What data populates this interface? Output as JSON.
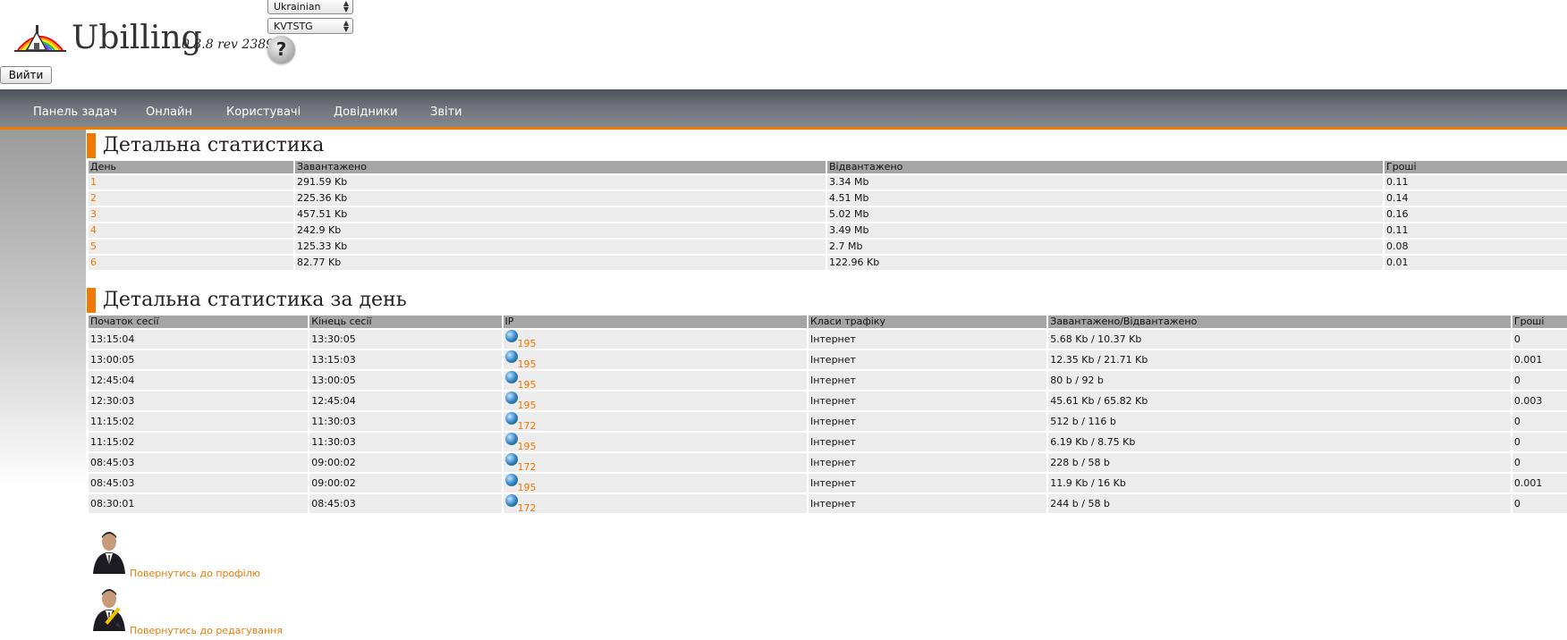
{
  "header": {
    "app_name": "Ubilling",
    "version": "0.3.8 rev 2389",
    "language_select": "Ukrainian",
    "skin_select": "KVTSTG",
    "help_symbol": "?",
    "logout_label": "Вийти"
  },
  "nav": {
    "items": [
      "Панель задач",
      "Онлайн",
      "Користувачі",
      "Довідники",
      "Звіти"
    ]
  },
  "colors": {
    "accent": "#f07a00",
    "nav_bg": "#6f727a"
  },
  "section1": {
    "title": "Детальна статистика",
    "columns": [
      "День",
      "Завантажено",
      "Відвантажено",
      "Гроші"
    ],
    "rows": [
      [
        "1",
        "291.59 Kb",
        "3.34 Mb",
        "0.11"
      ],
      [
        "2",
        "225.36 Kb",
        "4.51 Mb",
        "0.14"
      ],
      [
        "3",
        "457.51 Kb",
        "5.02 Mb",
        "0.16"
      ],
      [
        "4",
        "242.9 Kb",
        "3.49 Mb",
        "0.11"
      ],
      [
        "5",
        "125.33 Kb",
        "2.7 Mb",
        "0.08"
      ],
      [
        "6",
        "82.77 Kb",
        "122.96 Kb",
        "0.01"
      ]
    ]
  },
  "section2": {
    "title": "Детальна статистика за день",
    "columns": [
      "Початок сесії",
      "Кінець сесії",
      "IP",
      "Класи трафіку",
      "Завантажено/Відвантажено",
      "Гроші"
    ],
    "rows": [
      [
        "13:15:04",
        "13:30:05",
        "195",
        "Інтернет",
        "5.68 Kb / 10.37 Kb",
        "0"
      ],
      [
        "13:00:05",
        "13:15:03",
        "195",
        "Інтернет",
        "12.35 Kb / 21.71 Kb",
        "0.001"
      ],
      [
        "12:45:04",
        "13:00:05",
        "195",
        "Інтернет",
        "80 b / 92 b",
        "0"
      ],
      [
        "12:30:03",
        "12:45:04",
        "195",
        "Інтернет",
        "45.61 Kb / 65.82 Kb",
        "0.003"
      ],
      [
        "11:15:02",
        "11:30:03",
        "172",
        "Інтернет",
        "512 b / 116 b",
        "0"
      ],
      [
        "11:15:02",
        "11:30:03",
        "195",
        "Інтернет",
        "6.19 Kb / 8.75 Kb",
        "0"
      ],
      [
        "08:45:03",
        "09:00:02",
        "172",
        "Інтернет",
        "228 b / 58 b",
        "0"
      ],
      [
        "08:45:03",
        "09:00:02",
        "195",
        "Інтернет",
        "11.9 Kb / 16 Kb",
        "0.001"
      ],
      [
        "08:30:01",
        "08:45:03",
        "172",
        "Інтернет",
        "244 b / 58 b",
        "0"
      ]
    ]
  },
  "footer": {
    "back_profile": "Повернутись до профілю",
    "back_edit": "Повернутись до редагування"
  }
}
